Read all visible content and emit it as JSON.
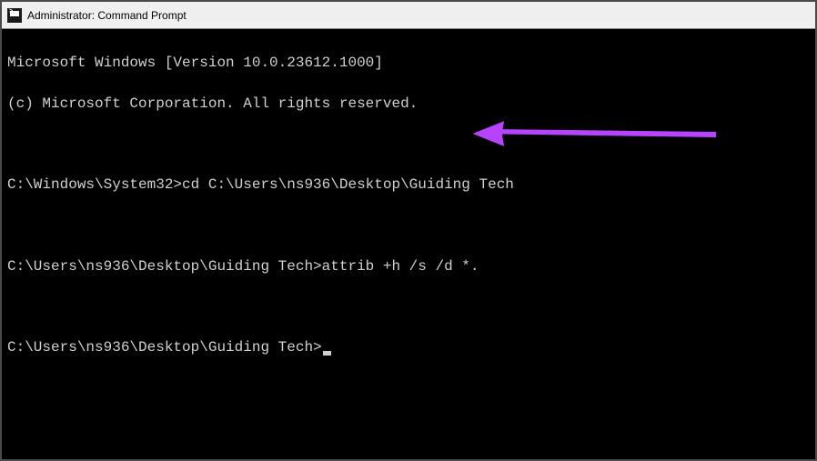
{
  "title": "Administrator: Command Prompt",
  "header": {
    "version_line": "Microsoft Windows [Version 10.0.23612.1000]",
    "copyright_line": "(c) Microsoft Corporation. All rights reserved."
  },
  "lines": [
    {
      "prompt": "C:\\Windows\\System32>",
      "command": "cd C:\\Users\\ns936\\Desktop\\Guiding Tech"
    },
    {
      "prompt": "C:\\Users\\ns936\\Desktop\\Guiding Tech>",
      "command": "attrib +h /s /d *."
    },
    {
      "prompt": "C:\\Users\\ns936\\Desktop\\Guiding Tech>",
      "command": ""
    }
  ],
  "arrow": {
    "color": "#b843ff",
    "visible": true
  }
}
